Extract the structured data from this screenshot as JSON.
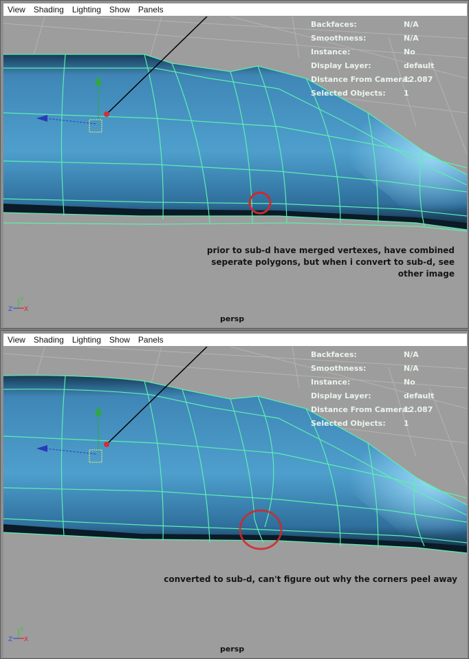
{
  "menus": [
    "View",
    "Shading",
    "Lighting",
    "Show",
    "Panels"
  ],
  "panels": [
    {
      "hud": [
        {
          "label": "Backfaces:",
          "value": "N/A"
        },
        {
          "label": "Smoothness:",
          "value": "N/A"
        },
        {
          "label": "Instance:",
          "value": "No"
        },
        {
          "label": "Display Layer:",
          "value": "default"
        },
        {
          "label": "Distance From Camera:",
          "value": "12.087"
        },
        {
          "label": "Selected Objects:",
          "value": "1"
        }
      ],
      "note_lines": [
        "prior to sub-d have merged vertexes, have combined",
        "seperate polygons, but when i convert to sub-d, see",
        "other image"
      ],
      "camera": "persp"
    },
    {
      "hud": [
        {
          "label": "Backfaces:",
          "value": "N/A"
        },
        {
          "label": "Smoothness:",
          "value": "N/A"
        },
        {
          "label": "Instance:",
          "value": "No"
        },
        {
          "label": "Display Layer:",
          "value": "default"
        },
        {
          "label": "Distance From Camera:",
          "value": "12.087"
        },
        {
          "label": "Selected Objects:",
          "value": "1"
        }
      ],
      "note_lines": [
        "converted to sub-d, can't figure out why the corners peel away"
      ],
      "camera": "persp"
    }
  ],
  "axes": {
    "x": "X",
    "y": "Y",
    "z": "Z"
  },
  "colors": {
    "viewport_bg": "#9d9d9d",
    "mesh_blue": "#3f8fbf",
    "wireframe": "#5cf0b0",
    "hud_text": "#eaf4ec",
    "highlight_circle": "#d0282c"
  }
}
